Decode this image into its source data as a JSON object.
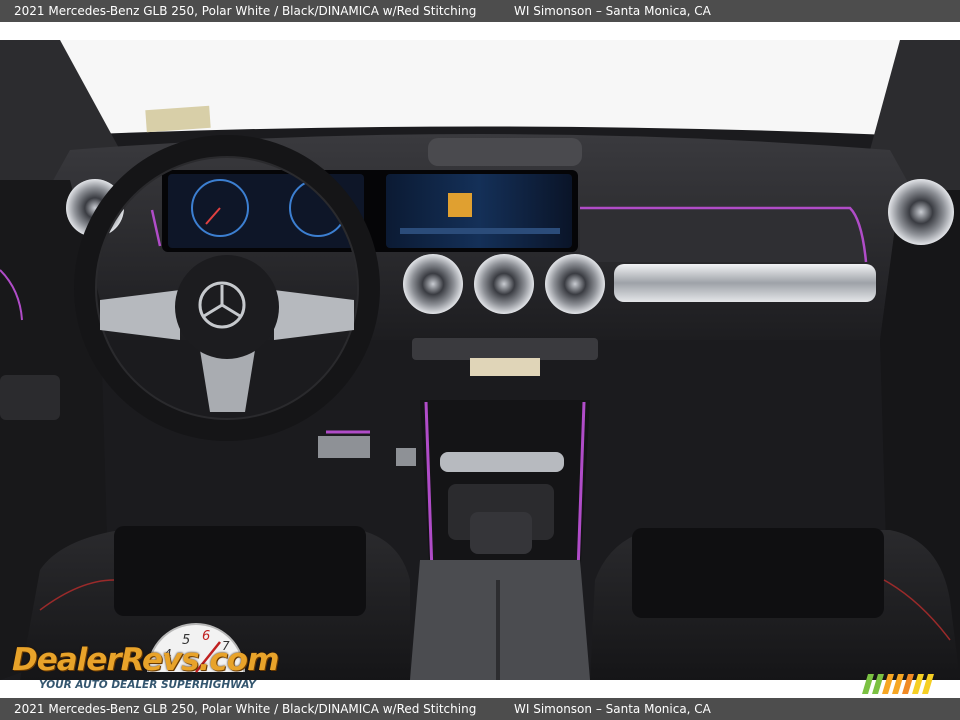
{
  "caption": {
    "vehicle": "2021 Mercedes-Benz GLB 250,  Polar White / Black/DINAMICA w/Red Stitching",
    "dealer": "WI Simonson – Santa Monica, CA"
  },
  "photo": {
    "subject": "interior-dashboard-photo",
    "colors": {
      "dash": "#232326",
      "seat": "#202022",
      "ambient_light": "#b04cc8",
      "chrome": "#cfd2d6",
      "screen": "#12203a",
      "windshield": "#f7f7f7"
    }
  },
  "watermark": {
    "brand": "DealerRevs.com",
    "tagline": "YOUR AUTO DEALER SUPERHIGHWAY",
    "gauge_digits": [
      "4",
      "5",
      "6",
      "7"
    ],
    "colors": {
      "brand": "#e8a32a",
      "tagline": "#34566f"
    }
  }
}
